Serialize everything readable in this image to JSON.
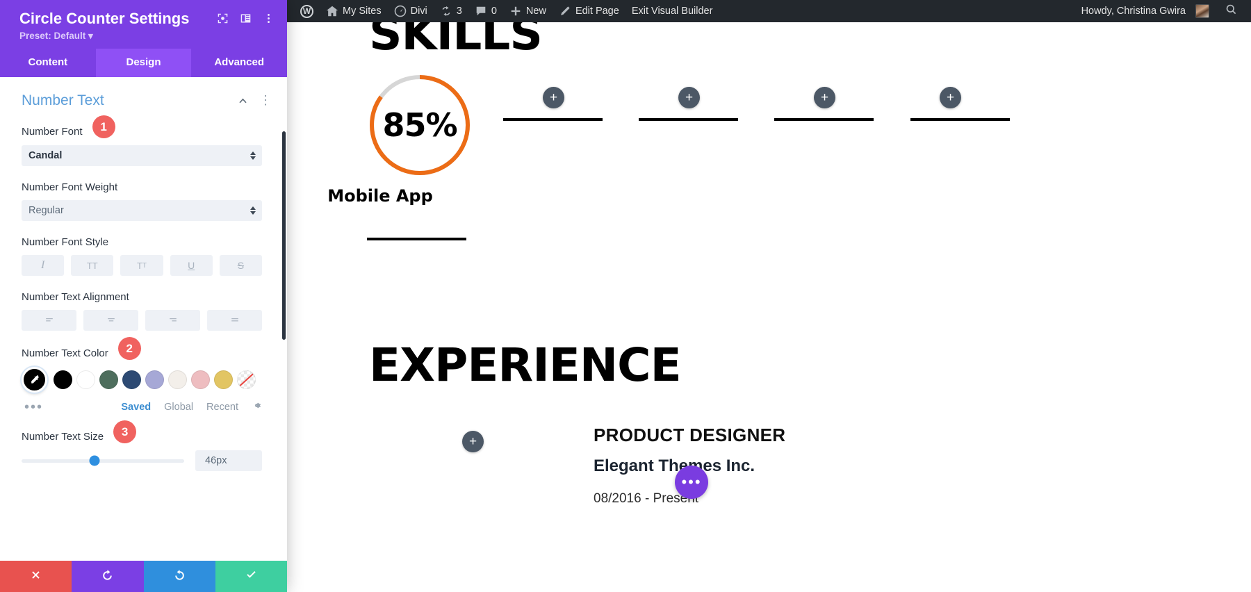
{
  "adminbar": {
    "items": [
      {
        "icon": "wordpress-logo-icon",
        "label": ""
      },
      {
        "icon": "home-icon",
        "label": "My Sites"
      },
      {
        "icon": "dashboard-icon",
        "label": "Divi"
      },
      {
        "icon": "updates-icon",
        "label": "3"
      },
      {
        "icon": "comments-icon",
        "label": "0"
      },
      {
        "icon": "plus-icon",
        "label": "New"
      },
      {
        "icon": "pencil-icon",
        "label": "Edit Page"
      },
      {
        "icon": "",
        "label": "Exit Visual Builder"
      }
    ],
    "howdy": "Howdy, Christina Gwira",
    "search_icon": "search-icon"
  },
  "panel": {
    "title": "Circle Counter Settings",
    "preset_label": "Preset: Default",
    "header_icons": [
      "focus-frame-icon",
      "layout-columns-icon",
      "kebab-menu-icon"
    ],
    "tabs": [
      {
        "label": "Content",
        "active": false
      },
      {
        "label": "Design",
        "active": true
      },
      {
        "label": "Advanced",
        "active": false
      }
    ],
    "section": {
      "title": "Number Text",
      "collapse_icon": "chevron-up-icon",
      "options_icon": "kebab-menu-icon"
    },
    "fields": {
      "number_font": {
        "label": "Number Font",
        "badge": "1",
        "value": "Candal"
      },
      "number_font_weight": {
        "label": "Number Font Weight",
        "value": "Regular"
      },
      "number_font_style": {
        "label": "Number Font Style",
        "buttons": [
          {
            "name": "italic-icon",
            "glyph": "I"
          },
          {
            "name": "uppercase-icon",
            "glyph": "TT"
          },
          {
            "name": "small-caps-icon",
            "glyph": "Tт"
          },
          {
            "name": "underline-icon",
            "glyph": "U"
          },
          {
            "name": "strikethrough-icon",
            "glyph": "S"
          }
        ]
      },
      "number_text_alignment": {
        "label": "Number Text Alignment",
        "buttons": [
          {
            "name": "align-left-icon"
          },
          {
            "name": "align-center-icon"
          },
          {
            "name": "align-right-icon"
          },
          {
            "name": "align-justify-icon"
          }
        ]
      },
      "number_text_color": {
        "label": "Number Text Color",
        "badge": "2",
        "picker_icon": "eyedropper-icon",
        "selected_index": 0,
        "swatches": [
          {
            "name": "color-swatch-black",
            "hex": "#000000"
          },
          {
            "name": "color-swatch-white",
            "hex": "#ffffff"
          },
          {
            "name": "color-swatch-green",
            "hex": "#4e6e5d"
          },
          {
            "name": "color-swatch-navy",
            "hex": "#2d4a73"
          },
          {
            "name": "color-swatch-periwinkle",
            "hex": "#a6a8d6"
          },
          {
            "name": "color-swatch-offwhite",
            "hex": "#f3efea"
          },
          {
            "name": "color-swatch-pink",
            "hex": "#eebdc0"
          },
          {
            "name": "color-swatch-gold",
            "hex": "#e2c563"
          },
          {
            "name": "color-swatch-transparent",
            "hex": "transparent"
          }
        ],
        "more_icon": "more-dots-icon",
        "tabs": [
          {
            "label": "Saved",
            "active": true
          },
          {
            "label": "Global",
            "active": false
          },
          {
            "label": "Recent",
            "active": false
          }
        ],
        "settings_icon": "gear-icon"
      },
      "number_text_size": {
        "label": "Number Text Size",
        "badge": "3",
        "value": "46px",
        "slider_percent": 45
      }
    },
    "footer": [
      {
        "name": "cancel-button",
        "icon": "close-icon"
      },
      {
        "name": "undo-button",
        "icon": "undo-icon"
      },
      {
        "name": "redo-button",
        "icon": "redo-icon"
      },
      {
        "name": "save-button",
        "icon": "check-icon"
      }
    ]
  },
  "canvas": {
    "skills_heading": "SKILLS",
    "experience_heading": "EXPERIENCE",
    "counter": {
      "number": "85%",
      "title": "Mobile App",
      "percent": 85,
      "bar_color": "#ec6c16",
      "track_color": "#d6d6d6"
    },
    "add_buttons": [
      "add-module-1",
      "add-module-2",
      "add-module-3",
      "add-module-4",
      "add-module-5"
    ],
    "job": {
      "title": "PRODUCT DESIGNER",
      "company": "Elegant Themes Inc.",
      "dates": "08/2016 - Present"
    },
    "fab_icon": "more-options-fab-icon"
  }
}
